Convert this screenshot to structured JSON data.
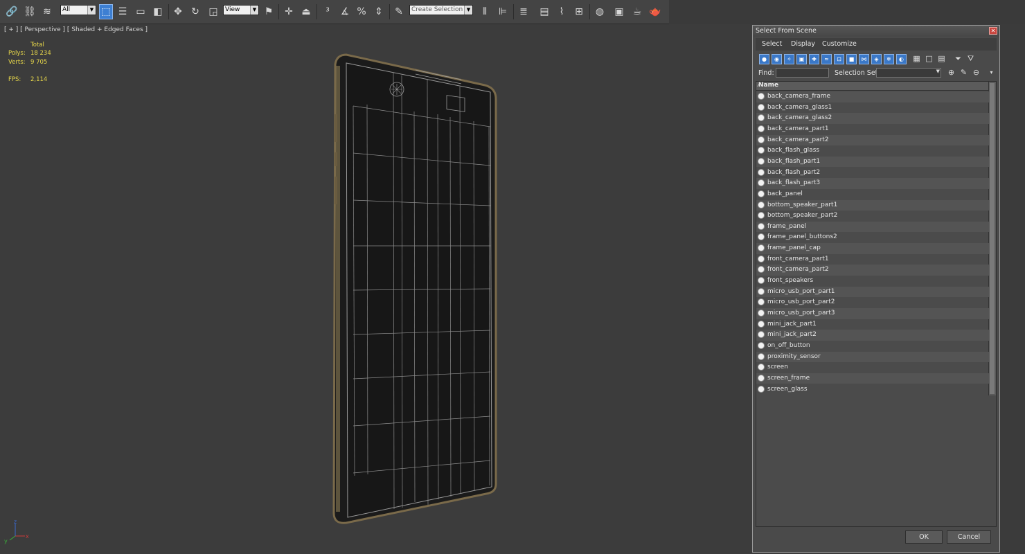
{
  "toolbar": {
    "filter_value": "All",
    "reference_value": "View",
    "selection_set_placeholder": "Create Selection Se"
  },
  "viewport": {
    "label": "[ + ] [ Perspective ] [ Shaded + Edged Faces ]",
    "stats": {
      "header": "Total",
      "polys_label": "Polys:",
      "polys_value": "18 234",
      "verts_label": "Verts:",
      "verts_value": "9 705",
      "fps_label": "FPS:",
      "fps_value": "2,114"
    },
    "axis": {
      "x": "x",
      "y": "y",
      "z": "z"
    }
  },
  "dialog": {
    "title": "Select From Scene",
    "menu": [
      "Select",
      "Display",
      "Customize"
    ],
    "find_label": "Find:",
    "selection_set_label": "Selection Set:",
    "column_name": "Name",
    "objects": [
      "back_camera_frame",
      "back_camera_glass1",
      "back_camera_glass2",
      "back_camera_part1",
      "back_camera_part2",
      "back_flash_glass",
      "back_flash_part1",
      "back_flash_part2",
      "back_flash_part3",
      "back_panel",
      "bottom_speaker_part1",
      "bottom_speaker_part2",
      "frame_panel",
      "frame_panel_buttons2",
      "frame_panel_cap",
      "front_camera_part1",
      "front_camera_part2",
      "front_speakers",
      "micro_usb_port_part1",
      "micro_usb_port_part2",
      "micro_usb_port_part3",
      "mini_jack_part1",
      "mini_jack_part2",
      "on_off_button",
      "proximity_sensor",
      "screen",
      "screen_frame",
      "screen_glass"
    ],
    "ok_label": "OK",
    "cancel_label": "Cancel"
  },
  "colors": {
    "accent": "#3d7fd2",
    "stats_text": "#e8d84a",
    "phone_frame": "#7a6a4a",
    "close_button": "#c8453e"
  }
}
